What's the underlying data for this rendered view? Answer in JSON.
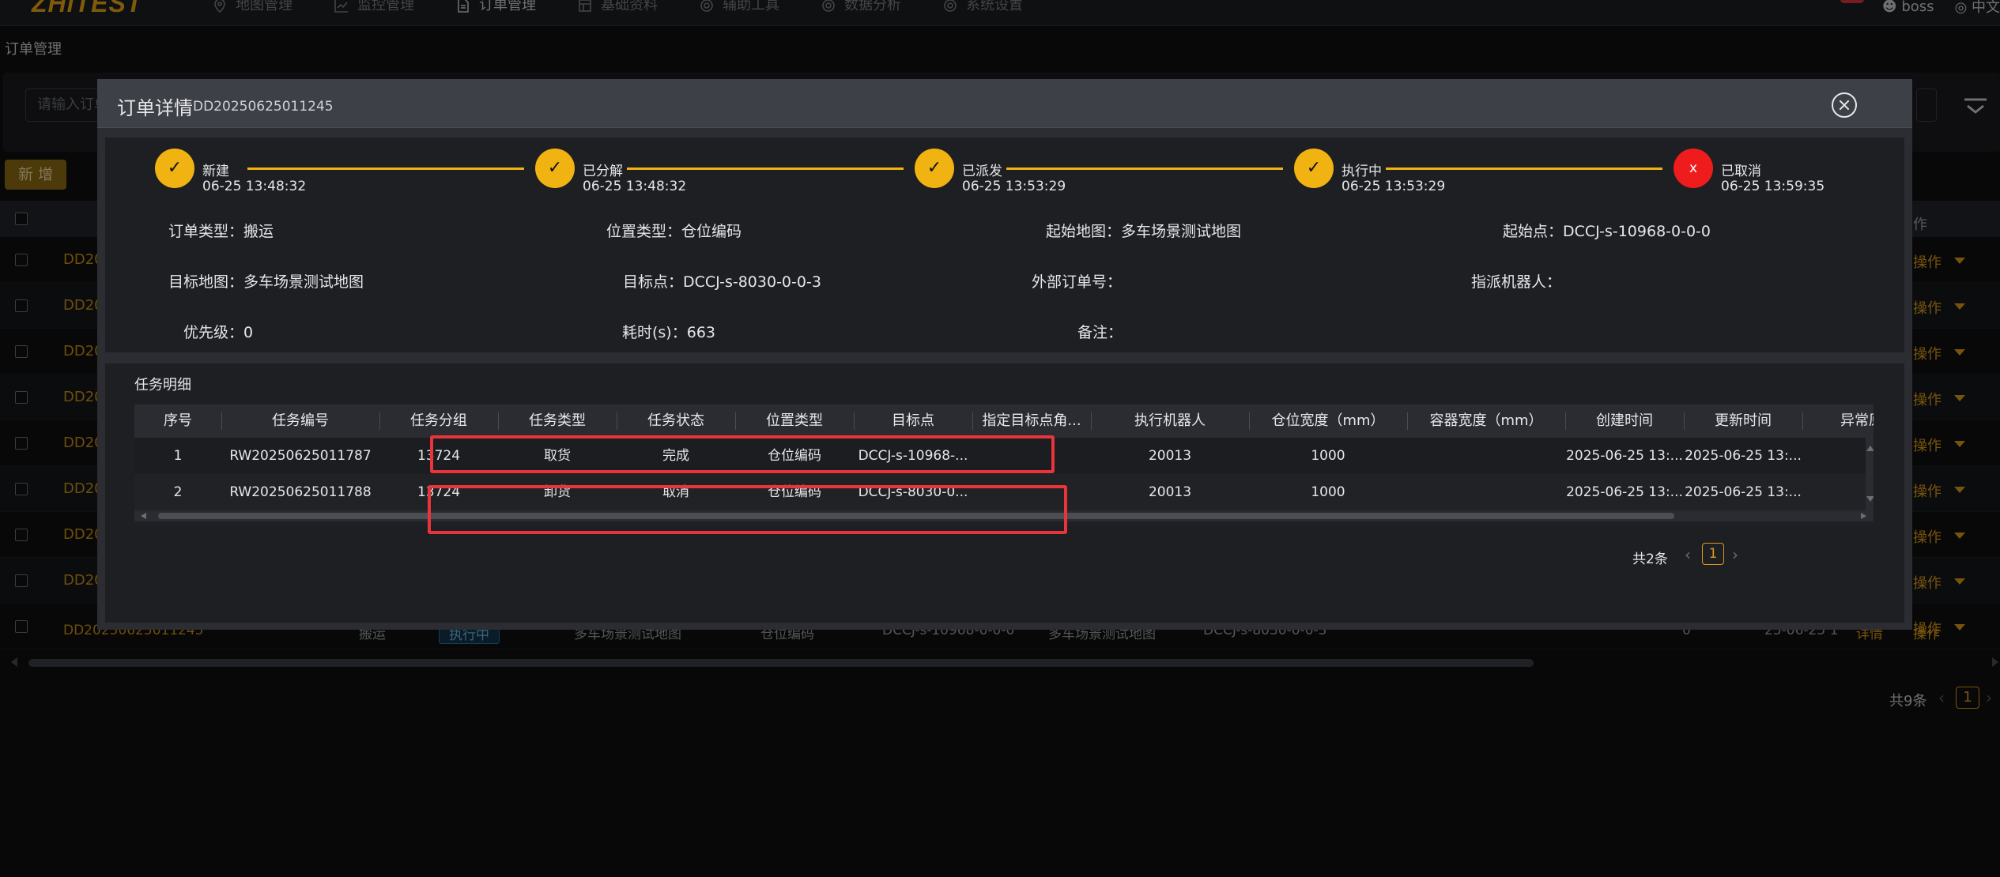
{
  "topbar": {
    "logo": "ZHiTEST",
    "nav": [
      {
        "label": "地图管理",
        "icon": "map-pin-icon"
      },
      {
        "label": "监控管理",
        "icon": "chart-line-icon"
      },
      {
        "label": "订单管理",
        "icon": "document-icon",
        "active": true
      },
      {
        "label": "基础资料",
        "icon": "database-icon"
      },
      {
        "label": "辅助工具",
        "icon": "gear-icon"
      },
      {
        "label": "数据分析",
        "icon": "gear-icon"
      },
      {
        "label": "系统设置",
        "icon": "gear-icon"
      }
    ],
    "user": "boss",
    "language": "中文"
  },
  "breadcrumb": "订单管理",
  "search": {
    "placeholder": "请输入订单"
  },
  "add_button": "新 增",
  "bg_table": {
    "op_header": "作",
    "row_id_prefix": "DD20",
    "op_label": "操作",
    "last_row": {
      "id": "DD20250625011245",
      "type": "搬运",
      "status": "执行中",
      "start_map": "多车场景测试地图",
      "pos_type": "仓位编码",
      "start_point": "DCCJ-s-10968-0-0-0",
      "target_map": "多车场景测试地图",
      "target_point": "DCCJ-s-8030-0-0-3",
      "zero": "0",
      "time": "25-06-25 1",
      "detail": "详情"
    },
    "total": "共9条",
    "page": "1"
  },
  "modal": {
    "title": "订单详情",
    "order_code": "DD20250625011245",
    "steps": [
      {
        "label": "新建",
        "time": "06-25 13:48:32",
        "mark": "✓"
      },
      {
        "label": "已分解",
        "time": "06-25 13:48:32",
        "mark": "✓"
      },
      {
        "label": "已派发",
        "time": "06-25 13:53:29",
        "mark": "✓"
      },
      {
        "label": "执行中",
        "time": "06-25 13:53:29",
        "mark": "✓"
      },
      {
        "label": "已取消",
        "time": "06-25 13:59:35",
        "mark": "x"
      }
    ],
    "fields": {
      "order_type": {
        "label": "订单类型：",
        "value": "搬运"
      },
      "pos_type": {
        "label": "位置类型：",
        "value": "仓位编码"
      },
      "start_map": {
        "label": "起始地图：",
        "value": "多车场景测试地图"
      },
      "start_point": {
        "label": "起始点：",
        "value": "DCCJ-s-10968-0-0-0"
      },
      "target_map": {
        "label": "目标地图：",
        "value": "多车场景测试地图"
      },
      "target_point": {
        "label": "目标点：",
        "value": "DCCJ-s-8030-0-0-3"
      },
      "ext_order": {
        "label": "外部订单号：",
        "value": ""
      },
      "robot": {
        "label": "指派机器人：",
        "value": ""
      },
      "priority": {
        "label": "优先级：",
        "value": "0"
      },
      "duration": {
        "label": "耗时(s)：",
        "value": "663"
      },
      "remark": {
        "label": "备注：",
        "value": ""
      }
    },
    "task_section_title": "任务明细",
    "task_columns": [
      "序号",
      "任务编号",
      "任务分组",
      "任务类型",
      "任务状态",
      "位置类型",
      "目标点",
      "指定目标点角...",
      "执行机器人",
      "仓位宽度（mm）",
      "容器宽度（mm）",
      "创建时间",
      "更新时间",
      "异常原"
    ],
    "task_rows": [
      [
        "1",
        "RW20250625011787",
        "13724",
        "取货",
        "完成",
        "仓位编码",
        "DCCJ-s-10968-...",
        "",
        "20013",
        "1000",
        "",
        "2025-06-25 13:...",
        "2025-06-25 13:...",
        ""
      ],
      [
        "2",
        "RW20250625011788",
        "13724",
        "卸货",
        "取消",
        "仓位编码",
        "DCCJ-s-8030-0...",
        "",
        "20013",
        "1000",
        "",
        "2025-06-25 13:...",
        "2025-06-25 13:...",
        ""
      ]
    ],
    "total": "共2条",
    "page": "1"
  },
  "colors": {
    "accent": "#f0b312",
    "cancel": "#ee1c1c",
    "highlight": "#e8343a"
  }
}
